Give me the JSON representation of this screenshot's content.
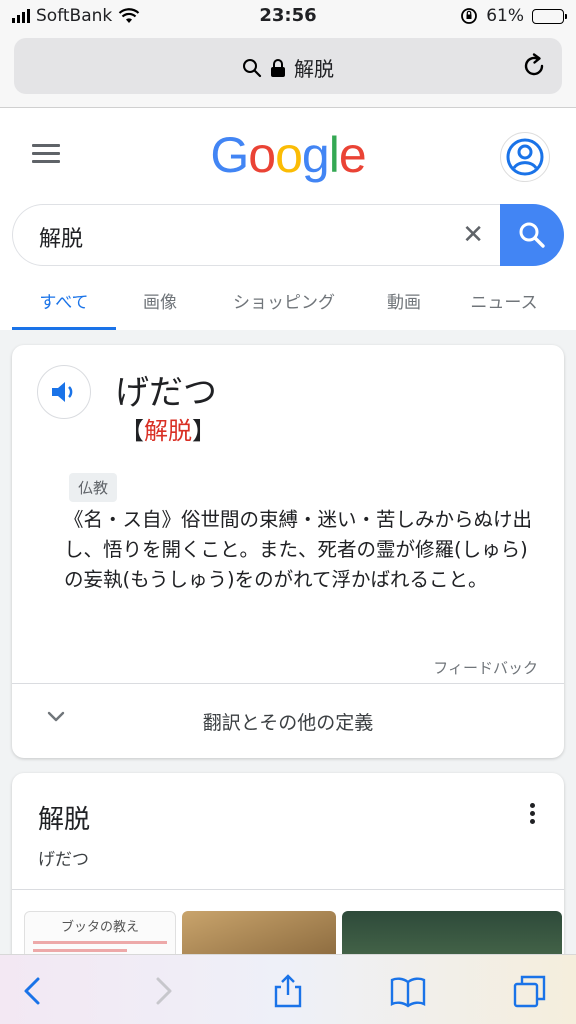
{
  "status_bar": {
    "carrier": "SoftBank",
    "time": "23:56",
    "battery": "61%",
    "battery_level": 0.61
  },
  "url_bar": {
    "query": "解脱"
  },
  "google": {
    "logo": [
      "G",
      "o",
      "o",
      "g",
      "l",
      "e"
    ],
    "logo_colors": [
      "#4285f4",
      "#ea4335",
      "#fbbc05",
      "#4285f4",
      "#34a853",
      "#ea4335"
    ],
    "search_value": "解脱",
    "clear_symbol": "✕",
    "tabs": [
      "すべて",
      "画像",
      "ショッピング",
      "動画",
      "ニュース"
    ]
  },
  "dictionary": {
    "reading": "げだつ",
    "headword_open": "【",
    "headword_kanji": "解脱",
    "headword_close": "】",
    "tag": "仏教",
    "definition": "《名・ス自》俗世間の束縛・迷い・苦しみからぬけ出し、悟りを開くこと。また、死者の霊が修羅(しゅら)の妄執(もうしゅう)をのがれて浮かばれること。",
    "feedback": "フィードバック",
    "more_label": "翻訳とその他の定義"
  },
  "knowledge_panel": {
    "title": "解脱",
    "subtitle": "げだつ",
    "thumb1_title": "ブッタの教え"
  },
  "colors": {
    "accent": "#1a73e8",
    "search_button": "#4285f4",
    "headword_red": "#d93025"
  }
}
